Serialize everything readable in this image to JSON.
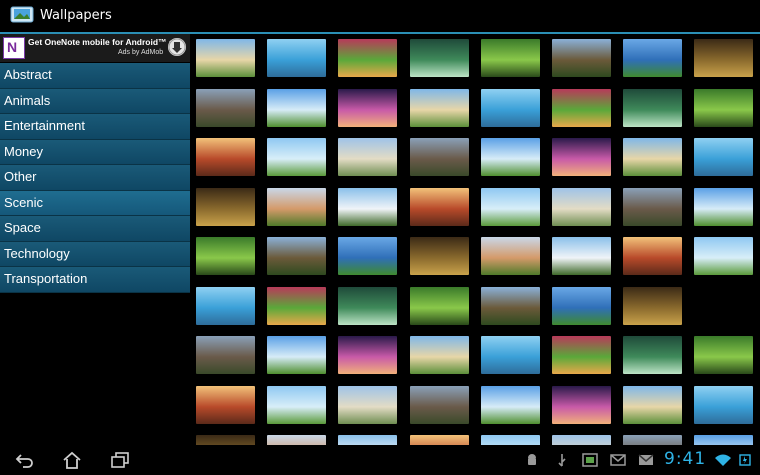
{
  "app": {
    "title": "Wallpapers",
    "icon": "wallpaper-app-icon"
  },
  "ad": {
    "headline": "Get OneNote mobile for Android™ app",
    "sub": "Ads by AdMob",
    "brand_letter": "N",
    "icon": "onenote-icon",
    "button_icon": "download-icon"
  },
  "categories": [
    {
      "label": "Abstract"
    },
    {
      "label": "Animals"
    },
    {
      "label": "Entertainment"
    },
    {
      "label": "Money"
    },
    {
      "label": "Other"
    },
    {
      "label": "Scenic"
    },
    {
      "label": "Space"
    },
    {
      "label": "Technology"
    },
    {
      "label": "Transportation"
    }
  ],
  "selected_category": "Scenic",
  "status": {
    "time": "9:41"
  },
  "colors": {
    "accent": "#2b8fb5",
    "category_bg": "#15587a",
    "clock": "#2fb3e6"
  }
}
